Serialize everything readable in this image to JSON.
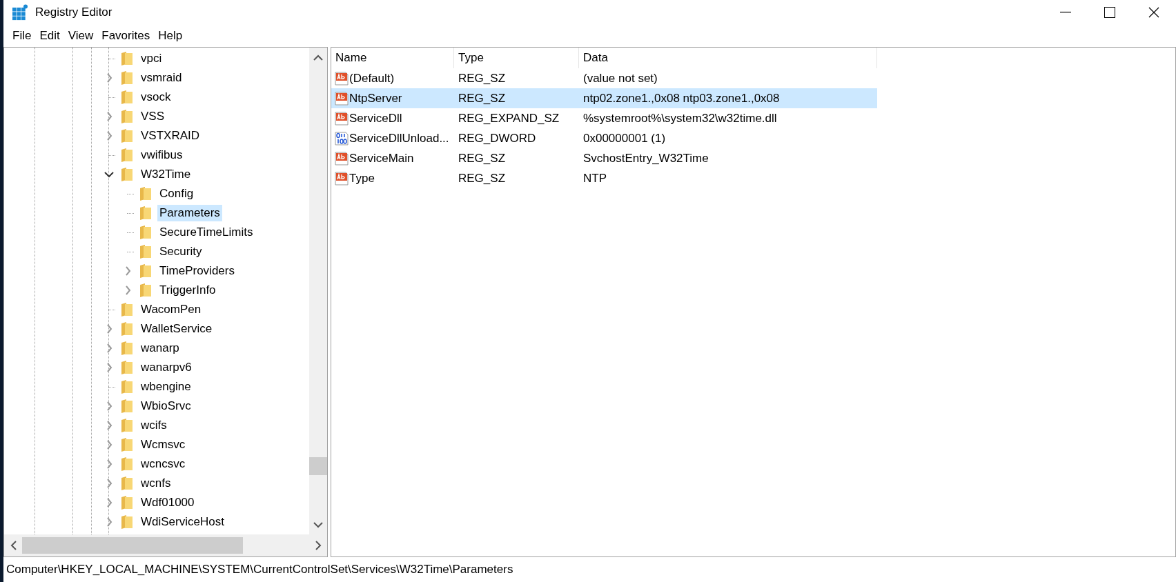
{
  "window": {
    "title": "Registry Editor"
  },
  "menu": [
    "File",
    "Edit",
    "View",
    "Favorites",
    "Help"
  ],
  "tree": [
    {
      "label": "vpci",
      "kind": "leaf",
      "selected": false
    },
    {
      "label": "vsmraid",
      "kind": "collapsed",
      "selected": false
    },
    {
      "label": "vsock",
      "kind": "leaf",
      "selected": false
    },
    {
      "label": "VSS",
      "kind": "collapsed",
      "selected": false
    },
    {
      "label": "VSTXRAID",
      "kind": "collapsed",
      "selected": false
    },
    {
      "label": "vwifibus",
      "kind": "leaf",
      "selected": false
    },
    {
      "label": "W32Time",
      "kind": "expanded",
      "selected": false,
      "children": [
        {
          "label": "Config",
          "kind": "leaf",
          "selected": false
        },
        {
          "label": "Parameters",
          "kind": "leaf",
          "selected": true
        },
        {
          "label": "SecureTimeLimits",
          "kind": "leaf",
          "selected": false
        },
        {
          "label": "Security",
          "kind": "leaf",
          "selected": false
        },
        {
          "label": "TimeProviders",
          "kind": "collapsed",
          "selected": false
        },
        {
          "label": "TriggerInfo",
          "kind": "collapsed",
          "selected": false
        }
      ]
    },
    {
      "label": "WacomPen",
      "kind": "leaf",
      "selected": false
    },
    {
      "label": "WalletService",
      "kind": "collapsed",
      "selected": false
    },
    {
      "label": "wanarp",
      "kind": "collapsed",
      "selected": false
    },
    {
      "label": "wanarpv6",
      "kind": "collapsed",
      "selected": false
    },
    {
      "label": "wbengine",
      "kind": "leaf",
      "selected": false
    },
    {
      "label": "WbioSrvc",
      "kind": "collapsed",
      "selected": false
    },
    {
      "label": "wcifs",
      "kind": "collapsed",
      "selected": false
    },
    {
      "label": "Wcmsvc",
      "kind": "collapsed",
      "selected": false
    },
    {
      "label": "wcncsvc",
      "kind": "collapsed",
      "selected": false
    },
    {
      "label": "wcnfs",
      "kind": "collapsed",
      "selected": false
    },
    {
      "label": "Wdf01000",
      "kind": "collapsed",
      "selected": false
    },
    {
      "label": "WdiServiceHost",
      "kind": "collapsed",
      "selected": false
    }
  ],
  "values": {
    "columns": [
      "Name",
      "Type",
      "Data"
    ],
    "rows": [
      {
        "name": "(Default)",
        "type": "REG_SZ",
        "data": "(value not set)",
        "kind": "string",
        "selected": false
      },
      {
        "name": "NtpServer",
        "type": "REG_SZ",
        "data": "ntp02.zone1.,0x08 ntp03.zone1.,0x08",
        "kind": "string",
        "selected": true
      },
      {
        "name": "ServiceDll",
        "type": "REG_EXPAND_SZ",
        "data": "%systemroot%\\system32\\w32time.dll",
        "kind": "string",
        "selected": false
      },
      {
        "name": "ServiceDllUnload...",
        "type": "REG_DWORD",
        "data": "0x00000001 (1)",
        "kind": "binary",
        "selected": false
      },
      {
        "name": "ServiceMain",
        "type": "REG_SZ",
        "data": "SvchostEntry_W32Time",
        "kind": "string",
        "selected": false
      },
      {
        "name": "Type",
        "type": "REG_SZ",
        "data": "NTP",
        "kind": "string",
        "selected": false
      }
    ]
  },
  "status_bar": "Computer\\HKEY_LOCAL_MACHINE\\SYSTEM\\CurrentControlSet\\Services\\W32Time\\Parameters"
}
